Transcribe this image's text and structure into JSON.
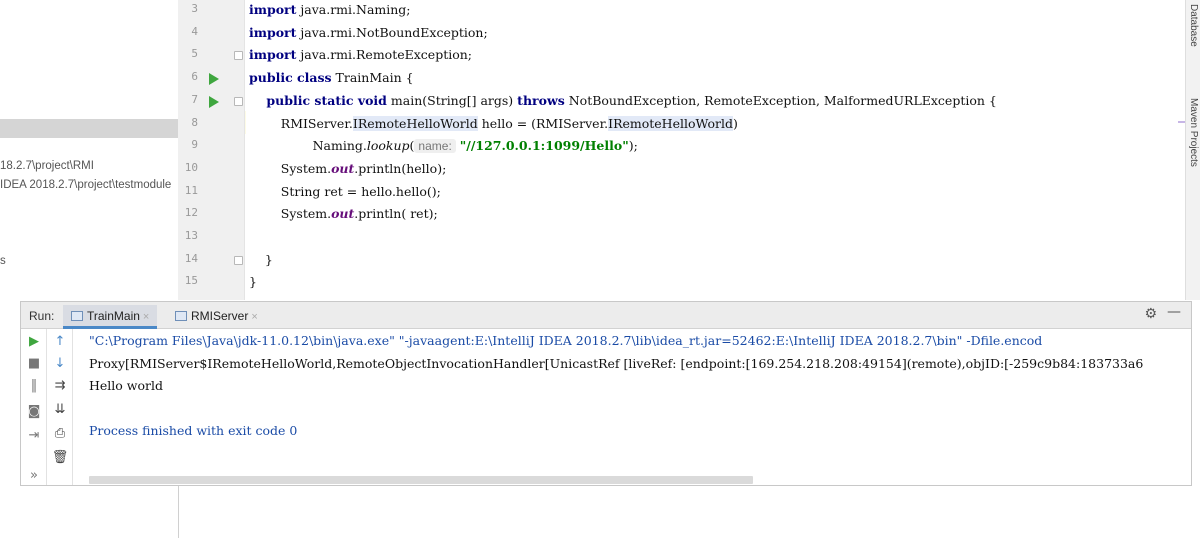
{
  "project_tree": {
    "lines": [
      "18.2.7\\project\\RMI",
      "IDEA 2018.2.7\\project\\testmodule",
      "s"
    ]
  },
  "editor": {
    "lines": [
      {
        "num": "3",
        "parts": [
          {
            "t": "import",
            "c": "kw"
          },
          {
            "t": " java.rmi.Naming;",
            "c": ""
          }
        ]
      },
      {
        "num": "4",
        "parts": [
          {
            "t": "import",
            "c": "kw"
          },
          {
            "t": " java.rmi.NotBoundException;",
            "c": ""
          }
        ]
      },
      {
        "num": "5",
        "parts": [
          {
            "t": "import",
            "c": "kw"
          },
          {
            "t": " java.rmi.RemoteException;",
            "c": ""
          }
        ]
      },
      {
        "num": "6",
        "parts": [
          {
            "t": "public class",
            "c": "kw"
          },
          {
            "t": " TrainMain {",
            "c": ""
          }
        ]
      },
      {
        "num": "7",
        "parts": [
          {
            "t": "    public static void",
            "c": "kw"
          },
          {
            "t": " main(String[] args) ",
            "c": ""
          },
          {
            "t": "throws",
            "c": "kw"
          },
          {
            "t": " NotBoundException, RemoteException, MalformedURLException {",
            "c": ""
          }
        ]
      },
      {
        "num": "8",
        "parts": [
          {
            "t": "        RMIServer.",
            "c": ""
          },
          {
            "t": "IRemoteHelloWorld",
            "c": "clhl"
          },
          {
            "t": " hello = (RMIServer.",
            "c": ""
          },
          {
            "t": "IRemoteHelloWorld",
            "c": "clhl"
          },
          {
            "t": ")",
            "c": ""
          }
        ]
      },
      {
        "num": "9",
        "parts": [
          {
            "t": "                Naming.",
            "c": ""
          },
          {
            "t": "lookup",
            "c": "lk"
          },
          {
            "t": "(",
            "c": ""
          },
          {
            "t": "name:",
            "c": "hint"
          },
          {
            "t": " ",
            "c": ""
          },
          {
            "t": "\"//127.0.0.1:1099/Hello\"",
            "c": "str"
          },
          {
            "t": ");",
            "c": ""
          }
        ]
      },
      {
        "num": "10",
        "parts": [
          {
            "t": "        System.",
            "c": ""
          },
          {
            "t": "out",
            "c": "it"
          },
          {
            "t": ".println(hello);",
            "c": ""
          }
        ]
      },
      {
        "num": "11",
        "parts": [
          {
            "t": "        String ret = hello.hello();",
            "c": ""
          }
        ]
      },
      {
        "num": "12",
        "parts": [
          {
            "t": "        System.",
            "c": ""
          },
          {
            "t": "out",
            "c": "it"
          },
          {
            "t": ".println( ret);",
            "c": ""
          }
        ]
      },
      {
        "num": "13",
        "parts": [
          {
            "t": "",
            "c": ""
          }
        ]
      },
      {
        "num": "14",
        "parts": [
          {
            "t": "    }",
            "c": ""
          }
        ]
      },
      {
        "num": "15",
        "parts": [
          {
            "t": "}",
            "c": ""
          }
        ]
      }
    ]
  },
  "right_strip": {
    "top_label": "Database",
    "bottom_label": "Maven Projects"
  },
  "run_panel": {
    "label": "Run:",
    "tabs": [
      {
        "label": "TrainMain"
      },
      {
        "label": "RMIServer"
      }
    ],
    "console": [
      {
        "text": "\"C:\\Program Files\\Java\\jdk-11.0.12\\bin\\java.exe\" \"-javaagent:E:\\IntelliJ IDEA 2018.2.7\\lib\\idea_rt.jar=52462:E:\\IntelliJ IDEA 2018.2.7\\bin\" -Dfile.encod",
        "color": "c-blue"
      },
      {
        "text": "Proxy[RMIServer$IRemoteHelloWorld,RemoteObjectInvocationHandler[UnicastRef [liveRef: [endpoint:[169.254.218.208:49154](remote),objID:[-259c9b84:183733a6",
        "color": "c-black"
      },
      {
        "text": "Hello world",
        "color": "c-black"
      },
      {
        "text": "",
        "color": "c-black"
      },
      {
        "text": "Process finished with exit code 0",
        "color": "c-blue"
      }
    ]
  },
  "icons": {
    "gear": "⚙",
    "minimize": "—",
    "close": "×"
  }
}
